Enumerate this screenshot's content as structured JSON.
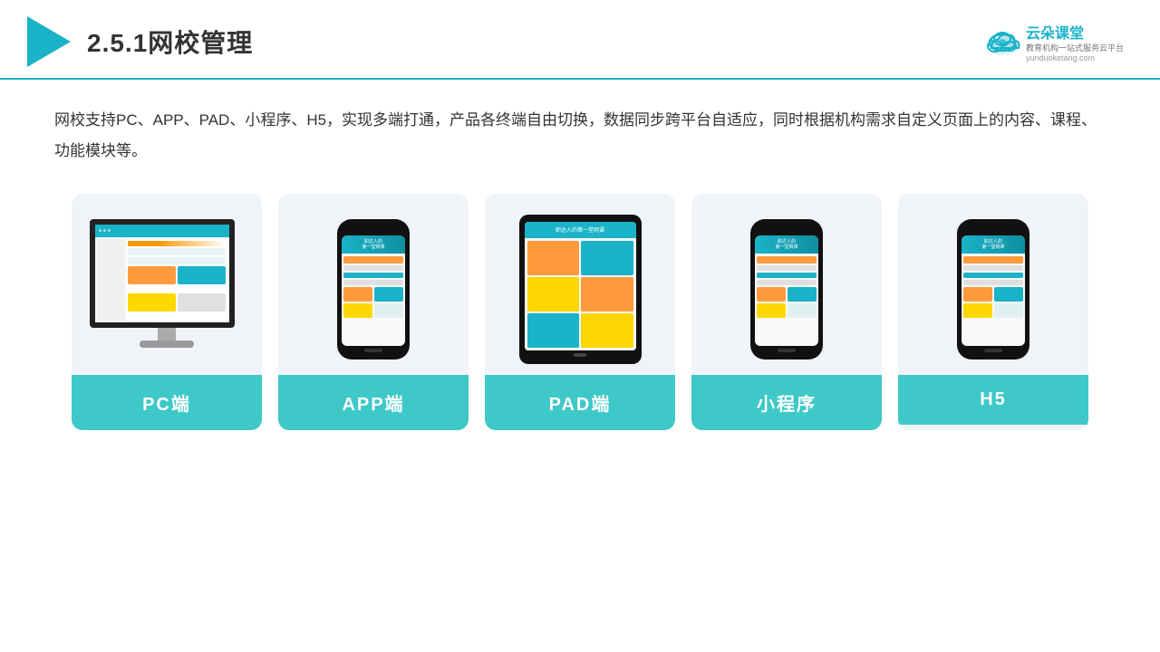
{
  "header": {
    "title": "2.5.1网校管理",
    "brand": {
      "name": "云朵课堂",
      "tagline": "教育机构一站\n式服务云平台",
      "url": "yunduoketang.com"
    }
  },
  "description": "网校支持PC、APP、PAD、小程序、H5，实现多端打通，产品各终端自由切换，数据同步跨平台自适应，同时根据机构需求自定义页面上的内容、课程、功能模块等。",
  "cards": [
    {
      "id": "pc",
      "label": "PC端",
      "type": "monitor"
    },
    {
      "id": "app",
      "label": "APP端",
      "type": "phone"
    },
    {
      "id": "pad",
      "label": "PAD端",
      "type": "tablet"
    },
    {
      "id": "miniapp",
      "label": "小程序",
      "type": "phone"
    },
    {
      "id": "h5",
      "label": "H5",
      "type": "phone"
    }
  ],
  "colors": {
    "accent": "#1ab3c8",
    "card_label_bg": "#3ec8c8",
    "card_bg": "#f0f4f8",
    "text_dark": "#333333",
    "border": "#1ab3c8"
  }
}
